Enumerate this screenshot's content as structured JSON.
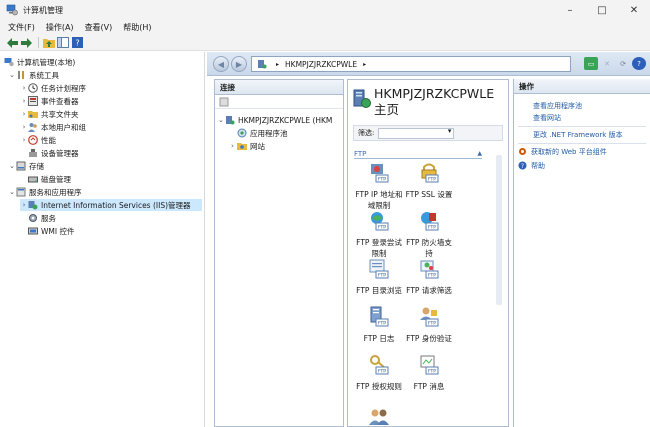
{
  "window": {
    "title": "计算机管理",
    "minimize": "–",
    "maximize": "□",
    "close": "✕"
  },
  "menu": [
    {
      "label": "文件(F)"
    },
    {
      "label": "操作(A)"
    },
    {
      "label": "查看(V)"
    },
    {
      "label": "帮助(H)"
    }
  ],
  "tree": {
    "root": "计算机管理(本地)",
    "system_tools": "系统工具",
    "task_scheduler": "任务计划程序",
    "event_viewer": "事件查看器",
    "shared_folders": "共享文件夹",
    "local_users": "本地用户和组",
    "performance": "性能",
    "device_manager": "设备管理器",
    "storage": "存储",
    "disk_management": "磁盘管理",
    "services_apps": "服务和应用程序",
    "iis_manager": "Internet Information Services (IIS)管理器",
    "services": "服务",
    "wmi": "WMI 控件"
  },
  "iis": {
    "address_segment": "HKMPJZJRZKCPWLE",
    "address_arrow": "▸",
    "connections_header": "连接",
    "conn_server": "HKMPJZJRZKCPWLE (HKM",
    "conn_app_pools": "应用程序池",
    "conn_sites": "网站",
    "home_title": "HKMPJZJRZKCPWLE 主页",
    "filter_label": "筛选:",
    "group_label": "FTP",
    "features": [
      {
        "label": "FTP IP 地址和域限制"
      },
      {
        "label": "FTP SSL 设置"
      },
      {
        "label": "FTP 登录尝试限制"
      },
      {
        "label": "FTP 防火墙支持"
      },
      {
        "label": "FTP 目录浏览"
      },
      {
        "label": "FTP 请求筛选"
      },
      {
        "label": "FTP 日志"
      },
      {
        "label": "FTP 身份验证"
      },
      {
        "label": "FTP 授权规则"
      },
      {
        "label": "FTP 消息"
      }
    ],
    "actions_header": "操作",
    "actions": [
      {
        "label": "查看应用程序池"
      },
      {
        "label": "查看网站"
      },
      {
        "label": "更改 .NET Framework 版本"
      },
      {
        "label": "获取新的 Web 平台组件"
      },
      {
        "label": "帮助"
      }
    ]
  },
  "colors": {
    "link": "#1f5ba8",
    "selection": "#cce8ff",
    "annotation": "#e00000"
  }
}
